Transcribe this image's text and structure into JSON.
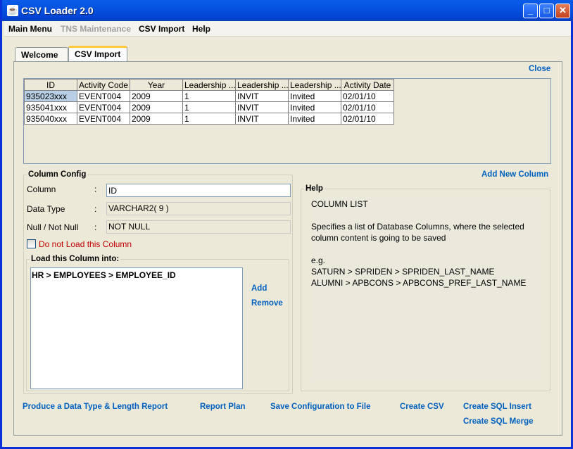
{
  "window": {
    "title": "CSV Loader 2.0",
    "min": "_",
    "max": "□",
    "close": "✕"
  },
  "menu": {
    "main_menu": "Main Menu",
    "tns_maintenance": "TNS Maintenance",
    "csv_import": "CSV Import",
    "help": "Help"
  },
  "tabs": {
    "welcome": "Welcome",
    "csv_import": "CSV Import"
  },
  "links": {
    "close": "Close",
    "add_new_column": "Add New Column",
    "add": "Add",
    "remove": "Remove",
    "produce_report": "Produce a Data Type & Length Report",
    "report_plan": "Report Plan",
    "save_config": "Save Configuration to File",
    "create_csv": "Create CSV",
    "create_sql_insert": "Create SQL Insert",
    "create_sql_merge": "Create SQL Merge"
  },
  "grid": {
    "headers": [
      "ID",
      "Activity Code",
      "Year",
      "Leadership ...",
      "Leadership ...",
      "Leadership ...",
      "Activity Date"
    ],
    "rows": [
      [
        "935023xxx",
        "EVENT004",
        "2009",
        "1",
        "INVIT",
        "Invited",
        "02/01/10"
      ],
      [
        "935041xxx",
        "EVENT004",
        "2009",
        "1",
        "INVIT",
        "Invited",
        "02/01/10"
      ],
      [
        "935040xxx",
        "EVENT004",
        "2009",
        "1",
        "INVIT",
        "Invited",
        "02/01/10"
      ]
    ]
  },
  "column_config": {
    "legend": "Column Config",
    "column_label": "Column",
    "column_value": "ID",
    "data_type_label": "Data Type",
    "data_type_value": "VARCHAR2( 9 )",
    "null_label": "Null / Not Null",
    "null_value": "NOT NULL",
    "colon": ":",
    "do_not_load": "Do not Load this Column",
    "do_not_load_checked": false,
    "load_into_legend": "Load this Column into:",
    "load_into_items": [
      "HR > EMPLOYEES > EMPLOYEE_ID"
    ]
  },
  "help": {
    "legend": "Help",
    "line1": "COLUMN LIST",
    "line2": "Specifies a list of Database Columns, where the selected",
    "line3": "column content is going to be saved",
    "line4": "e.g.",
    "line5": "SATURN > SPRIDEN > SPRIDEN_LAST_NAME",
    "line6": "ALUMNI > APBCONS > APBCONS_PREF_LAST_NAME"
  }
}
